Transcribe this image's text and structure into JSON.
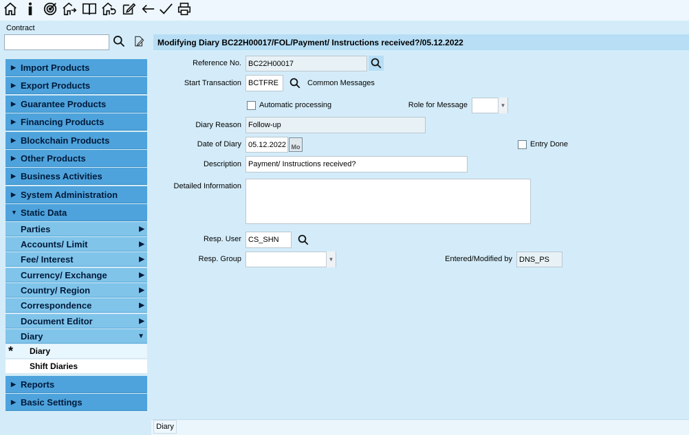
{
  "toolbar": {
    "icons": [
      "home-icon",
      "info-icon",
      "target-icon",
      "house-arrow-icon",
      "book-icon",
      "house-refresh-icon",
      "edit-icon",
      "back-arrow-icon",
      "check-icon",
      "print-icon"
    ]
  },
  "contract": {
    "label": "Contract",
    "value": ""
  },
  "menu": {
    "import": "Import Products",
    "export": "Export Products",
    "guarantee": "Guarantee Products",
    "financing": "Financing Products",
    "blockchain": "Blockchain Products",
    "other": "Other Products",
    "business": "Business Activities",
    "sysadmin": "System Administration",
    "static": "Static Data",
    "parties": "Parties",
    "accounts": "Accounts/ Limit",
    "fee": "Fee/ Interest",
    "currency": "Currency/ Exchange",
    "country": "Country/ Region",
    "correspondence": "Correspondence",
    "doceditor": "Document Editor",
    "diary_group": "Diary",
    "diary": "Diary",
    "shift": "Shift Diaries",
    "reports": "Reports",
    "basic": "Basic Settings",
    "active_marker": "*"
  },
  "form": {
    "title": "Modifying Diary BC22H00017/FOL/Payment/ Instructions received?/05.12.2022",
    "reference_label": "Reference No.",
    "reference_value": "BC22H00017",
    "start_label": "Start Transaction",
    "start_value": "BCTFRE",
    "common_messages": "Common Messages",
    "auto_label": "Automatic processing",
    "role_label": "Role for Message",
    "role_value": "",
    "reason_label": "Diary Reason",
    "reason_value": "Follow-up",
    "date_label": "Date of Diary",
    "date_value": "05.12.2022",
    "calendar_icon_text": "Mo",
    "entry_done_label": "Entry Done",
    "description_label": "Description",
    "description_value": "Payment/ Instructions received?",
    "detailed_label": "Detailed Information",
    "detailed_value": "",
    "resp_user_label": "Resp. User",
    "resp_user_value": "CS_SHN",
    "resp_group_label": "Resp. Group",
    "resp_group_value": "",
    "entered_label": "Entered/Modified by",
    "entered_value": "DNS_PS"
  },
  "status": {
    "tab": "Diary"
  }
}
